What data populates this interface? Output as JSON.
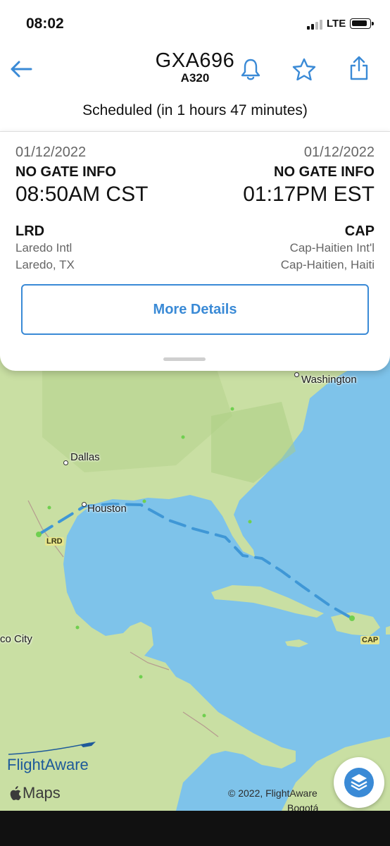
{
  "status_bar": {
    "time": "08:02",
    "network": "LTE"
  },
  "header": {
    "flight_number": "GXA696",
    "aircraft": "A320"
  },
  "status_text": "Scheduled (in 1 hours 47 minutes)",
  "departure": {
    "date": "01/12/2022",
    "gate": "NO GATE INFO",
    "time": "08:50AM CST",
    "code": "LRD",
    "airport": "Laredo Intl",
    "city": "Laredo, TX"
  },
  "arrival": {
    "date": "01/12/2022",
    "gate": "NO GATE INFO",
    "time": "01:17PM EST",
    "code": "CAP",
    "airport": "Cap-Haitien Int'l",
    "city": "Cap-Haitien, Haiti"
  },
  "more_details_label": "More Details",
  "map": {
    "labels": {
      "washington": "Washington",
      "dallas": "Dallas",
      "houston": "Houston",
      "mexico_city": "co City",
      "bogota": "Bogotá"
    },
    "airport_labels": {
      "origin": "LRD",
      "destination": "CAP"
    },
    "route_color": "#3f97d6",
    "water_color": "#7ec3ea",
    "land_color": "#c9dfa3"
  },
  "branding": {
    "flightaware": "FlightAware",
    "apple_maps": "Maps"
  },
  "copyright": "© 2022, FlightAware",
  "colors": {
    "accent": "#3a8ad6"
  }
}
